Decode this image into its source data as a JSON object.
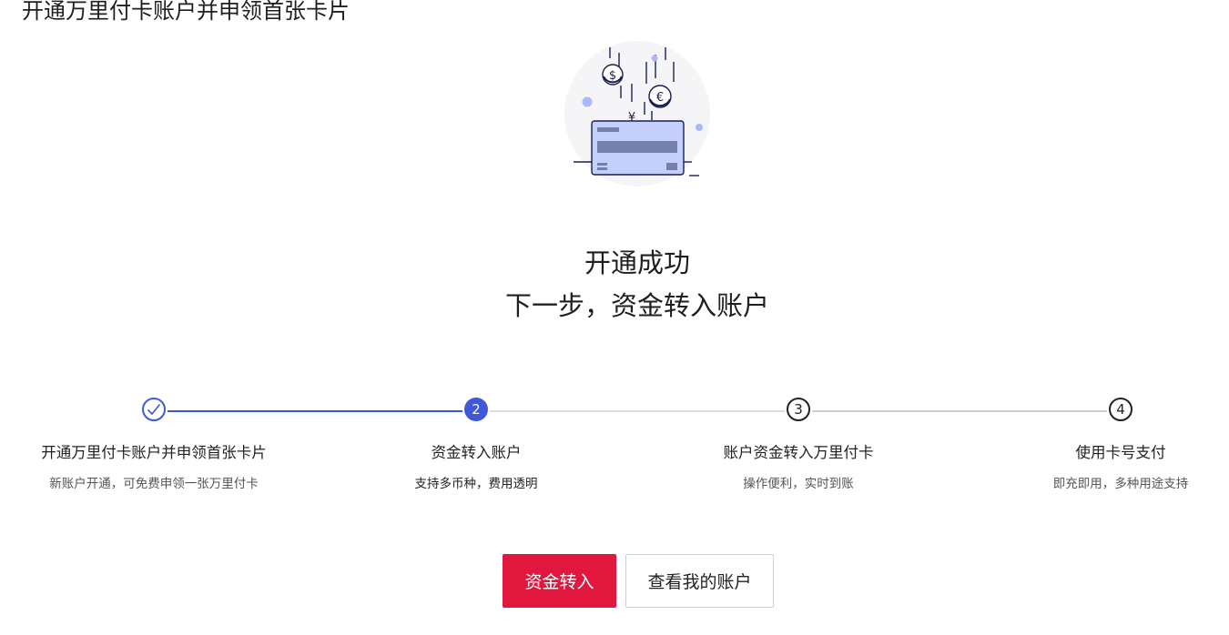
{
  "page": {
    "title": "开通万里付卡账户并申领首张卡片"
  },
  "result": {
    "title": "开通成功",
    "next_step": "下一步，资金转入账户"
  },
  "illustration": {
    "icon": "card-with-coins-icon",
    "coin_symbols": [
      "$",
      "€",
      "¥"
    ]
  },
  "steps": [
    {
      "number": "1",
      "status": "done",
      "title": "开通万里付卡账户并申领首张卡片",
      "desc": "新账户开通，可免费申领一张万里付卡"
    },
    {
      "number": "2",
      "status": "active",
      "title": "资金转入账户",
      "desc": "支持多币种，费用透明"
    },
    {
      "number": "3",
      "status": "todo",
      "title": "账户资金转入万里付卡",
      "desc": "操作便利，实时到账"
    },
    {
      "number": "4",
      "status": "todo",
      "title": "使用卡号支付",
      "desc": "即充即用，多种用途支持"
    }
  ],
  "actions": {
    "primary_label": "资金转入",
    "secondary_label": "查看我的账户"
  },
  "colors": {
    "accent_blue": "#3f57d9",
    "primary_red": "#e2173e",
    "card_fill": "#c5cffb"
  }
}
